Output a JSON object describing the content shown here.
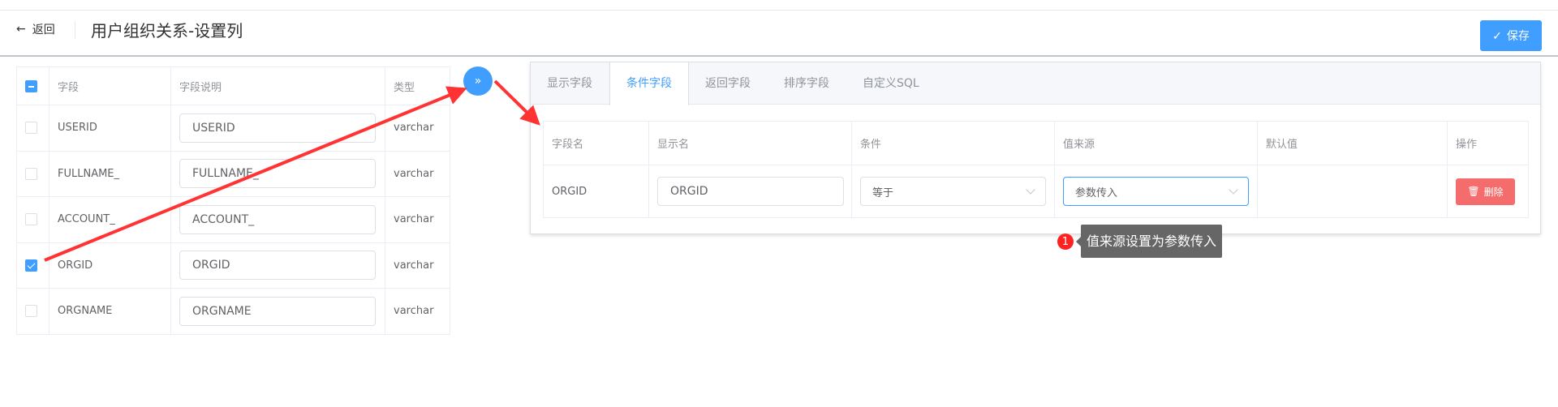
{
  "header": {
    "back_label": "返回",
    "title": "用户组织关系-设置列",
    "save_label": "保存"
  },
  "left_table": {
    "columns": [
      "字段",
      "字段说明",
      "类型"
    ],
    "rows": [
      {
        "field": "USERID",
        "desc": "USERID",
        "type": "varchar",
        "checked": false
      },
      {
        "field": "FULLNAME_",
        "desc": "FULLNAME_",
        "type": "varchar",
        "checked": false
      },
      {
        "field": "ACCOUNT_",
        "desc": "ACCOUNT_",
        "type": "varchar",
        "checked": false
      },
      {
        "field": "ORGID",
        "desc": "ORGID",
        "type": "varchar",
        "checked": true
      },
      {
        "field": "ORGNAME",
        "desc": "ORGNAME",
        "type": "varchar",
        "checked": false
      }
    ]
  },
  "move_button_icon": "double-chevron-right",
  "tabs": [
    "显示字段",
    "条件字段",
    "返回字段",
    "排序字段",
    "自定义SQL"
  ],
  "active_tab": "条件字段",
  "right_table": {
    "columns": [
      "字段名",
      "显示名",
      "条件",
      "值来源",
      "默认值",
      "操作"
    ],
    "row": {
      "field": "ORGID",
      "display": "ORGID",
      "condition": "等于",
      "source": "参数传入",
      "default": "",
      "delete_label": "删除"
    }
  },
  "annotation": {
    "number": "1",
    "text": "值来源设置为参数传入"
  },
  "colors": {
    "primary": "#409eff",
    "danger": "#f56c6c",
    "arrow": "#f33"
  }
}
